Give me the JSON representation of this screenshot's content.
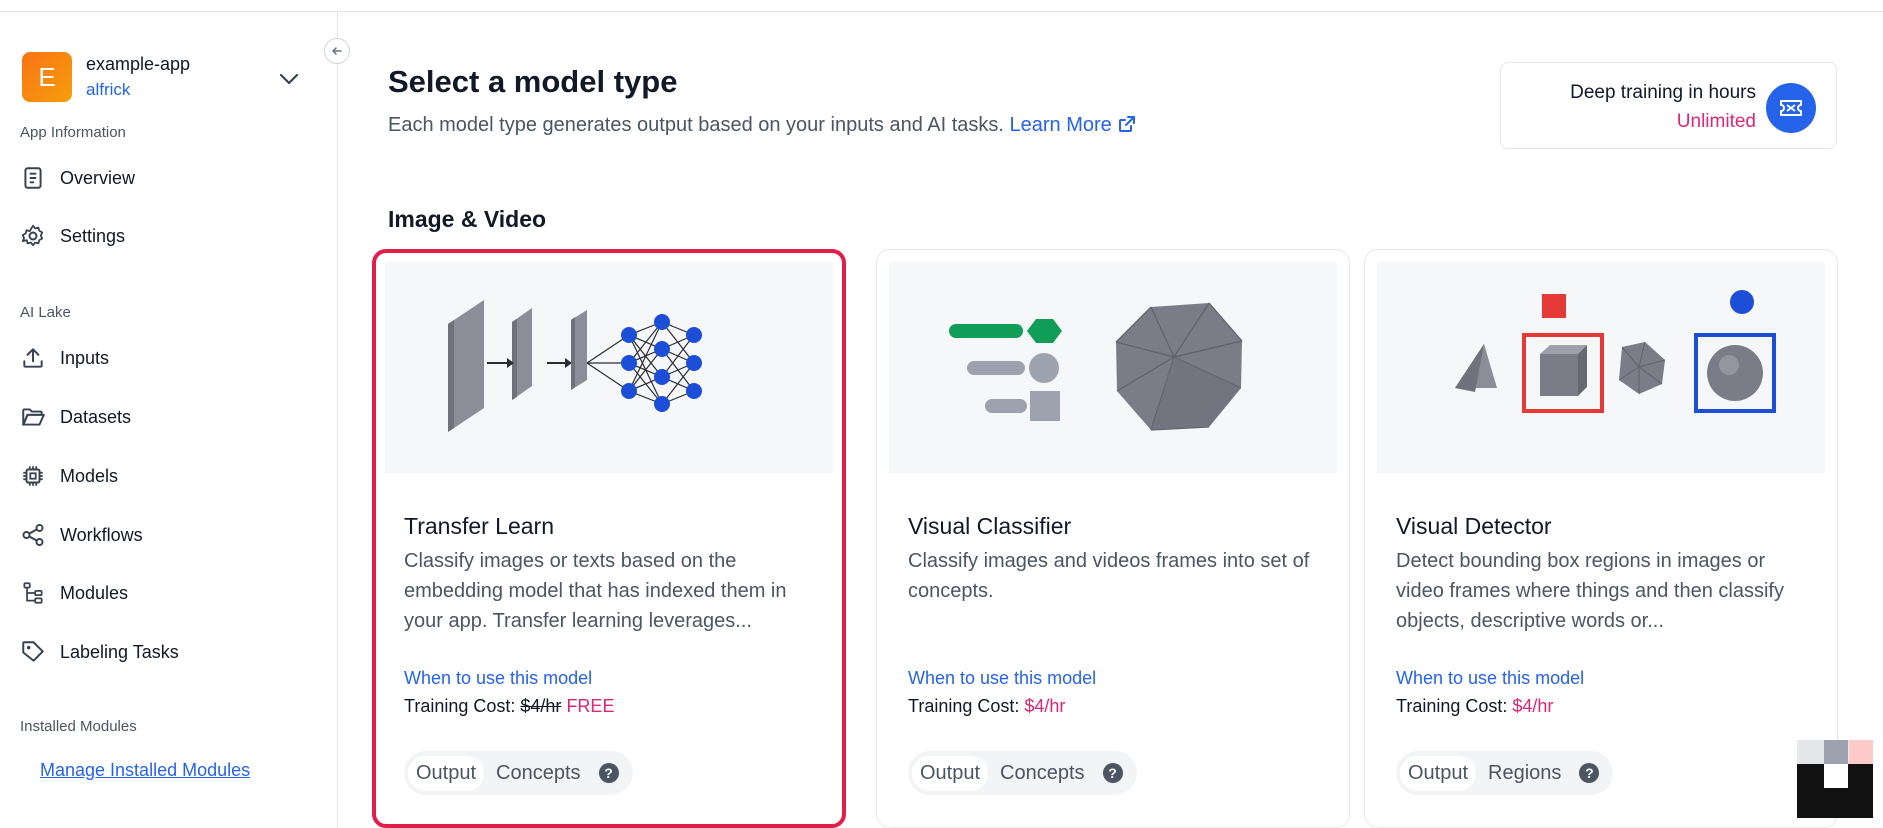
{
  "sidebar": {
    "app_initial": "E",
    "app_name": "example-app",
    "app_user": "alfrick",
    "sections": {
      "app_information": "App Information",
      "ai_lake": "AI Lake",
      "installed_modules": "Installed Modules"
    },
    "items": [
      {
        "label": "Overview",
        "icon": "document-icon"
      },
      {
        "label": "Settings",
        "icon": "gear-icon"
      },
      {
        "label": "Inputs",
        "icon": "upload-icon"
      },
      {
        "label": "Datasets",
        "icon": "folder-icon"
      },
      {
        "label": "Models",
        "icon": "chip-icon"
      },
      {
        "label": "Workflows",
        "icon": "share-icon"
      },
      {
        "label": "Modules",
        "icon": "tree-icon"
      },
      {
        "label": "Labeling Tasks",
        "icon": "tag-icon"
      }
    ],
    "manage_link": "Manage Installed Modules"
  },
  "header": {
    "title": "Select a model type",
    "subtitle": "Each model type generates output based on your inputs and AI tasks.",
    "learn_more": "Learn More"
  },
  "info_box": {
    "title": "Deep training in hours",
    "value": "Unlimited",
    "icon": "ticket-icon"
  },
  "section_title": "Image & Video",
  "cards": [
    {
      "title": "Transfer Learn",
      "description": "Classify images or texts based on the embedding model that has indexed them in your app. Transfer learning leverages...",
      "when_link": "When to use this model",
      "cost_label": "Training Cost:",
      "cost_price": "$4/hr",
      "cost_badge": "FREE",
      "tags": [
        "Output",
        "Concepts"
      ],
      "selected": true
    },
    {
      "title": "Visual Classifier",
      "description": "Classify images and videos frames into set of concepts.",
      "when_link": "When to use this model",
      "cost_label": "Training Cost:",
      "cost_price": "$4/hr",
      "tags": [
        "Output",
        "Concepts"
      ]
    },
    {
      "title": "Visual Detector",
      "description": "Detect bounding box regions in images or video frames where things and then classify objects, descriptive words or...",
      "when_link": "When to use this model",
      "cost_label": "Training Cost:",
      "cost_price": "$4/hr",
      "tags": [
        "Output",
        "Regions"
      ]
    }
  ],
  "colors": {
    "accent": "#2563eb",
    "pink": "#db2777",
    "selected_border": "#e11d48"
  }
}
